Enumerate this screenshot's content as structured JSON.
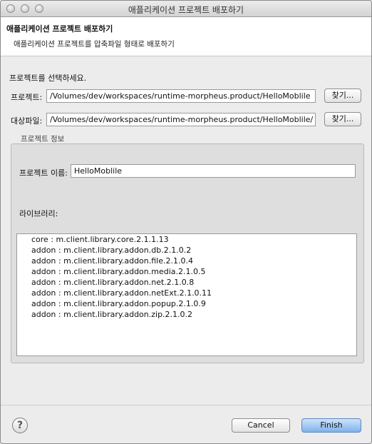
{
  "window": {
    "title": "애플리케이션 프로젝트 배포하기"
  },
  "header": {
    "title": "애플리케이션 프로젝트 배포하기",
    "description": "애플리케이션 프로젝트를 압축파일 형태로 배포하기"
  },
  "form": {
    "prompt": "프로젝트를 선택하세요.",
    "project_label": "프로젝트:",
    "project_value": "/Volumes/dev/workspaces/runtime-morpheus.product/HelloMoblile",
    "target_label": "대상파일:",
    "target_value": "/Volumes/dev/workspaces/runtime-morpheus.product/HelloMoblile/",
    "browse_label": "찾기..."
  },
  "info": {
    "group_title": "프로젝트 정보",
    "name_label": "프로젝트 이름:",
    "name_value": "HelloMoblile",
    "library_label": "라이브러리:",
    "libraries": [
      "core : m.client.library.core.2.1.1.13",
      "addon : m.client.library.addon.db.2.1.0.2",
      "addon : m.client.library.addon.file.2.1.0.4",
      "addon : m.client.library.addon.media.2.1.0.5",
      "addon : m.client.library.addon.net.2.1.0.8",
      "addon : m.client.library.addon.netExt.2.1.0.11",
      "addon : m.client.library.addon.popup.2.1.0.9",
      "addon : m.client.library.addon.zip.2.1.0.2"
    ]
  },
  "footer": {
    "help_glyph": "?",
    "cancel_label": "Cancel",
    "finish_label": "Finish"
  }
}
